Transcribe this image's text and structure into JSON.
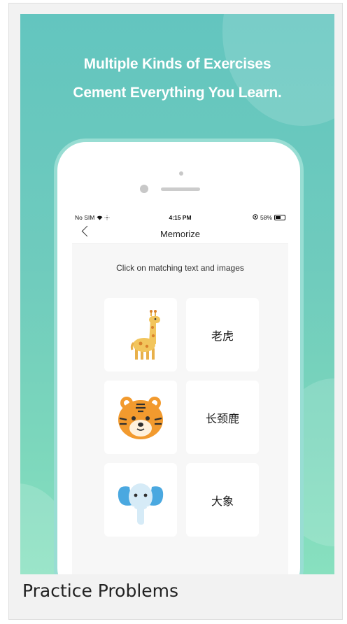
{
  "banner": {
    "headline_line1": "Multiple Kinds of Exercises",
    "headline_line2": "Cement Everything You Learn."
  },
  "statusbar": {
    "carrier": "No SIM",
    "time": "4:15 PM",
    "battery_text": "58%",
    "battery_level": 0.58
  },
  "navbar": {
    "title": "Memorize"
  },
  "exercise": {
    "instruction": "Click on matching text and images",
    "images": [
      {
        "icon": "giraffe-icon"
      },
      {
        "icon": "tiger-icon"
      },
      {
        "icon": "elephant-icon"
      }
    ],
    "words": [
      "老虎",
      "长颈鹿",
      "大象"
    ]
  },
  "caption": "Practice Problems",
  "colors": {
    "banner_top": "#63c5bf",
    "banner_bottom": "#88e0bf",
    "phone_rim": "#98ddd3"
  }
}
